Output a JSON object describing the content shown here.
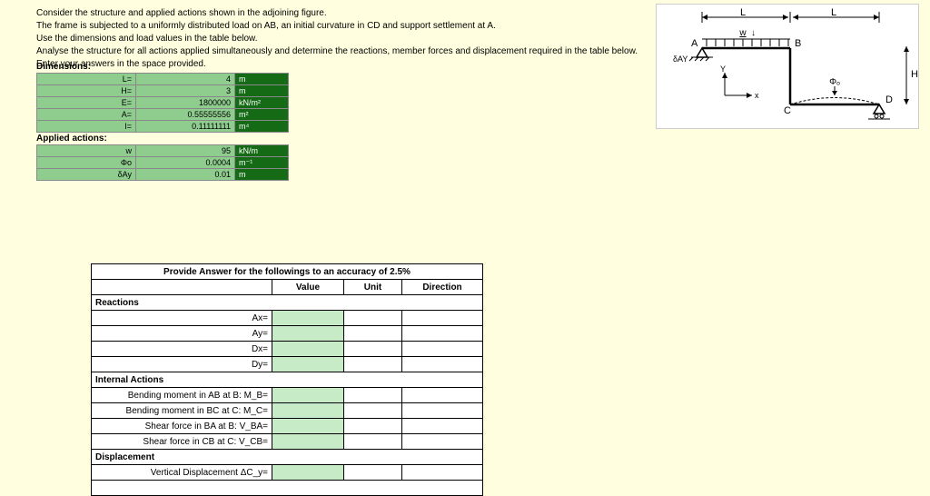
{
  "intro": {
    "l1": "Consider the structure and applied actions shown in the adjoining figure.",
    "l2": "The frame is subjected to a uniformly distributed load on AB, an initial curvature in CD and support settlement at A.",
    "l3": "Use the dimensions and load values in the table below.",
    "l4": "Analyse the structure for all actions applied simultaneously and determine the reactions, member forces and displacement required in the table below.",
    "l5": "Enter your answers in the space provided."
  },
  "dimensions": {
    "title": "Dimensions:",
    "rows": [
      {
        "label": "L=",
        "value": "4",
        "unit": "m"
      },
      {
        "label": "H=",
        "value": "3",
        "unit": "m"
      },
      {
        "label": "E=",
        "value": "1800000",
        "unit": "kN/m²"
      },
      {
        "label": "A=",
        "value": "0.55555556",
        "unit": "m²"
      },
      {
        "label": "I=",
        "value": "0.11111111",
        "unit": "m⁴"
      }
    ]
  },
  "actions": {
    "title": "Applied actions:",
    "rows": [
      {
        "label": "w",
        "value": "95",
        "unit": "kN/m"
      },
      {
        "label": "Φo",
        "value": "0.0004",
        "unit": "m⁻¹"
      },
      {
        "label": "δAy",
        "value": "0.01",
        "unit": "m"
      }
    ]
  },
  "figure": {
    "A": "A",
    "B": "B",
    "C": "C",
    "D": "D",
    "L": "L",
    "H": "H",
    "w": "w",
    "phi": "Φₒ",
    "delta": "δAY",
    "x": "x",
    "y": "Y"
  },
  "answers": {
    "caption": "Provide Answer for the followings to an accuracy of 2.5%",
    "head_value": "Value",
    "head_unit": "Unit",
    "head_dir": "Direction",
    "sections": {
      "reactions": "Reactions",
      "internal": "Internal Actions",
      "displacement": "Displacement"
    },
    "rows": {
      "ax": "Ax=",
      "ay": "Ay=",
      "dx": "Dx=",
      "dy": "Dy=",
      "mb": "Bending moment in AB at B: M_B=",
      "mc": "Bending moment in BC at C: M_C=",
      "vba": "Shear force in BA at B: V_BA=",
      "vcb": "Shear force in CB at C: V_CB=",
      "dcy": "Vertical Displacement ΔC_y="
    }
  }
}
